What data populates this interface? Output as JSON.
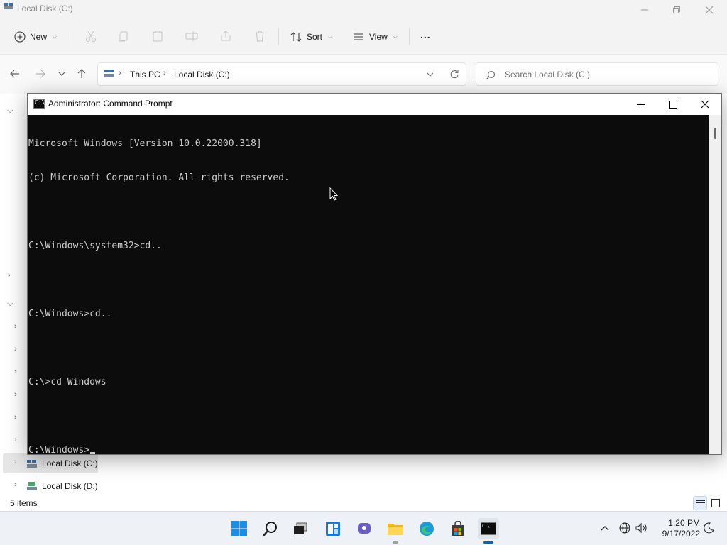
{
  "explorer": {
    "title": "Local Disk (C:)",
    "toolbar": {
      "new_label": "New",
      "sort_label": "Sort",
      "view_label": "View",
      "more_label": "..."
    },
    "address": {
      "crumbs": [
        "This PC",
        "Local Disk (C:)"
      ]
    },
    "search": {
      "placeholder": "Search Local Disk (C:)"
    },
    "navpane": {
      "items": [
        {
          "label": "Local Disk (C:)",
          "selected": true
        },
        {
          "label": "Local Disk (D:)",
          "selected": false
        }
      ]
    },
    "status": {
      "item_count": "5 items"
    }
  },
  "cmd": {
    "title": "Administrator: Command Prompt",
    "lines": [
      "Microsoft Windows [Version 10.0.22000.318]",
      "(c) Microsoft Corporation. All rights reserved.",
      "",
      "C:\\Windows\\system32>cd..",
      "",
      "C:\\Windows>cd..",
      "",
      "C:\\>cd Windows",
      "",
      "C:\\Windows>"
    ]
  },
  "taskbar": {
    "apps": [
      "start-icon",
      "search-icon",
      "task-view-icon",
      "widgets-icon",
      "chat-icon",
      "file-explorer-icon",
      "edge-icon",
      "store-icon",
      "terminal-icon"
    ],
    "clock": {
      "time": "1:20 PM",
      "date": "9/17/2022"
    }
  },
  "colors": {
    "accent": "#0067c0",
    "console_bg": "#0c0c0c",
    "console_text": "#cccccc"
  }
}
